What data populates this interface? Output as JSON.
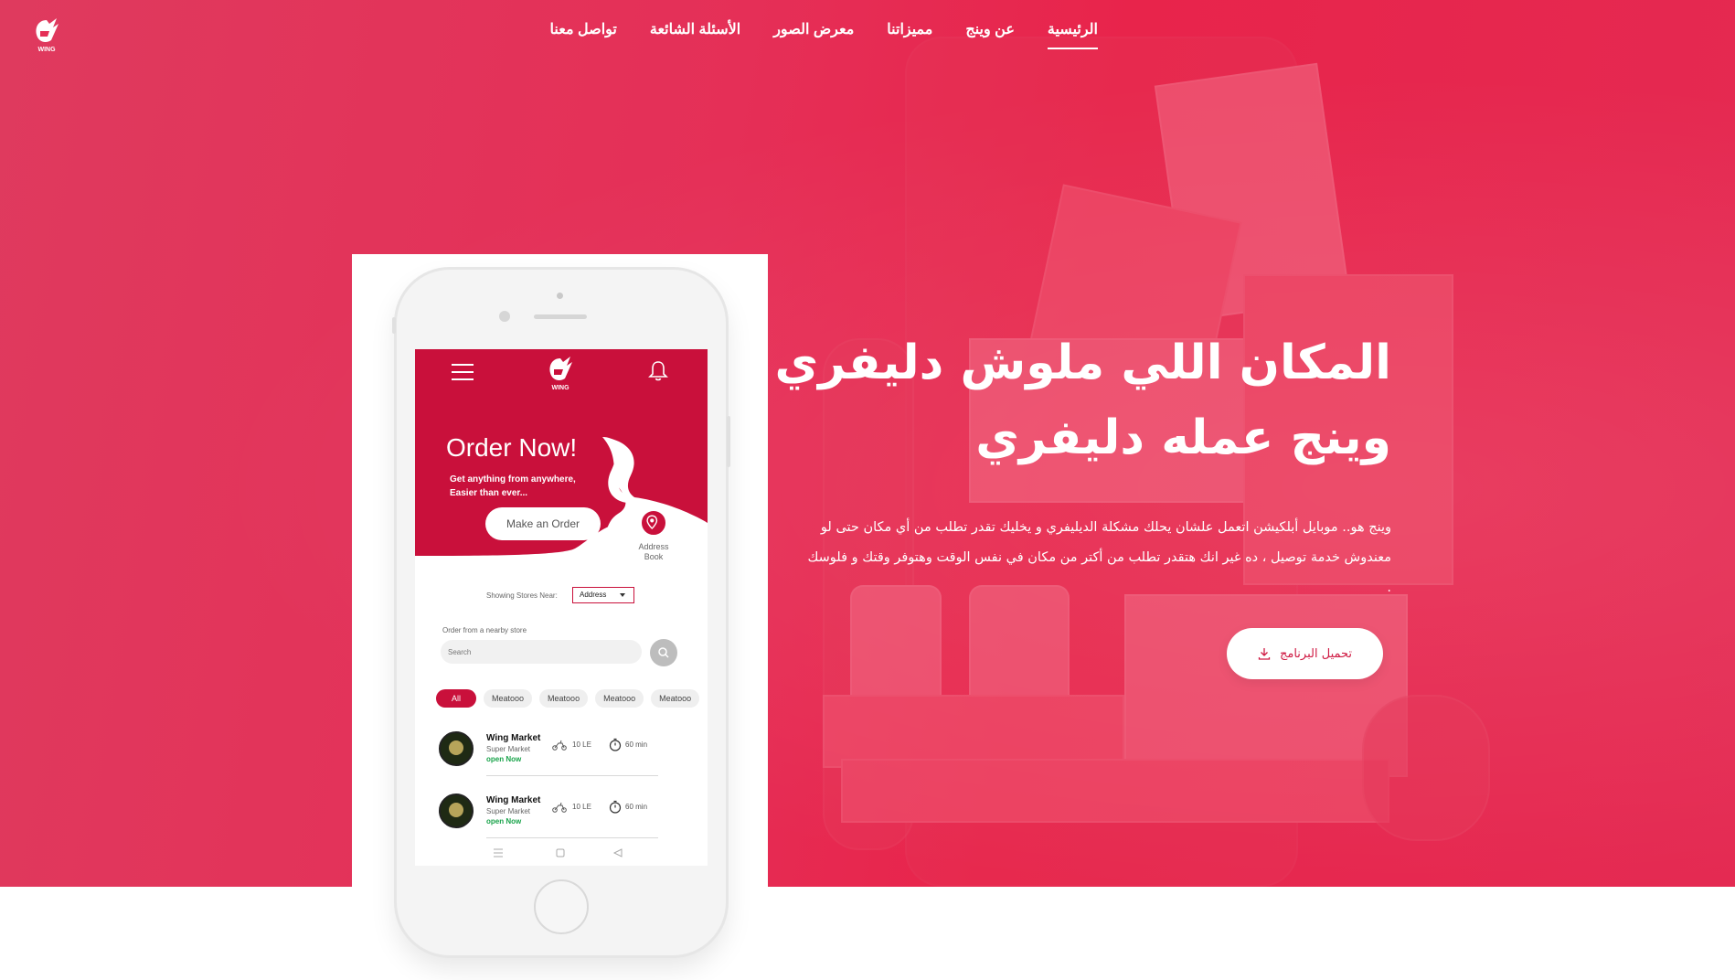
{
  "nav": {
    "items": [
      {
        "label": "الرئيسية",
        "active": true
      },
      {
        "label": "عن وينج",
        "active": false
      },
      {
        "label": "مميزاتنا",
        "active": false
      },
      {
        "label": "معرض الصور",
        "active": false
      },
      {
        "label": "الأسئلة الشائعة",
        "active": false
      },
      {
        "label": "تواصل معنا",
        "active": false
      }
    ]
  },
  "logo": {
    "icon": "wing-helmet-logo",
    "text": "WING"
  },
  "hero": {
    "headline_line1": "المكان اللي ملوش دليفري",
    "headline_line2": "وينج عمله دليفري",
    "paragraph": "وينج هو.. موبايل أبلكيشن اتعمل علشان يحلك مشكلة الديليفري و يخليك تقدر تطلب من أي مكان حتى لو معندوش خدمة توصيل ، ده غير انك هتقدر تطلب من أكتر من مكان في نفس الوقت وهتوفر وقتك و فلوسك .",
    "download_label": "تحميل البرنامج",
    "download_icon": "download-icon"
  },
  "app_mock": {
    "order_title": "Order Now!",
    "order_subtitle_1": "Get anything from anywhere,",
    "order_subtitle_2": "Easier than ever...",
    "make_order": "Make an Order",
    "address_book_1": "Address",
    "address_book_2": "Book",
    "showing_near": "Showing Stores Near:",
    "address_select": "Address",
    "order_from": "Order from a nearby store",
    "search_placeholder": "Search",
    "chips": [
      "All",
      "Meatooo",
      "Meatooo",
      "Meatooo",
      "Meatooo"
    ],
    "stores": [
      {
        "name": "Wing Market",
        "type": "Super Market",
        "status": "open Now",
        "fee": "10 LE",
        "time": "60 min"
      },
      {
        "name": "Wing Market",
        "type": "Super Market",
        "status": "open Now",
        "fee": "10 LE",
        "time": "60 min"
      }
    ]
  },
  "colors": {
    "brand": "#c9103b",
    "hero": "#e52f57",
    "open": "#19a34a"
  }
}
